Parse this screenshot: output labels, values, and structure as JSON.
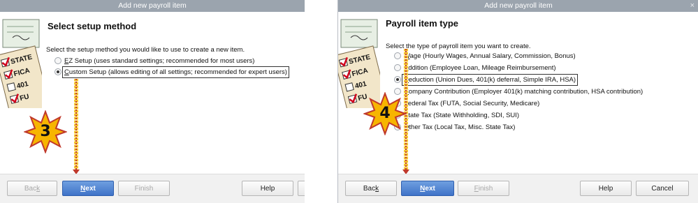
{
  "dialog1": {
    "title": "Add new payroll item",
    "heading": "Select setup method",
    "instruction": "Select the setup method you would like to use to create a new item.",
    "options": [
      {
        "mnemonic": "E",
        "rest": "Z Setup (uses standard settings; recommended for most users)",
        "selected": false
      },
      {
        "mnemonic": "C",
        "rest": "ustom Setup (allows editing of all settings; recommended for expert users)",
        "selected": true
      }
    ],
    "buttons": {
      "back_m": "Bac",
      "back_u": "k",
      "next_u": "N",
      "next_r": "ext",
      "finish": "Finish",
      "help": "Help"
    },
    "step_badge": "3"
  },
  "dialog2": {
    "title": "Add new payroll item",
    "close": "×",
    "heading": "Payroll item type",
    "instruction": "Select the type of payroll item you want to create.",
    "options": [
      {
        "mnemonic": "W",
        "rest": "age (Hourly Wages, Annual Salary, Commission, Bonus)",
        "selected": false
      },
      {
        "mnemonic": "A",
        "rest": "ddition (Employee Loan, Mileage Reimbursement)",
        "selected": false
      },
      {
        "mnemonic": "D",
        "rest": "eduction (Union Dues, 401(k) deferral, Simple IRA, HSA)",
        "selected": true
      },
      {
        "mnemonic": "C",
        "rest": "ompany Contribution (Employer 401(k) matching contribution, HSA contribution)",
        "selected": false
      },
      {
        "mnemonic": "F",
        "rest": "ederal Tax (FUTA, Social Security, Medicare)",
        "selected": false
      },
      {
        "mnemonic": "S",
        "rest": "tate Tax (State Withholding, SDI, SUI)",
        "selected": false
      },
      {
        "mnemonic": "O",
        "rest": "ther Tax (Local Tax, Misc. State Tax)",
        "selected": false
      }
    ],
    "buttons": {
      "back_m": "Bac",
      "back_u": "k",
      "next_u": "N",
      "next_r": "ext",
      "finish_u": "F",
      "finish_r": "inish",
      "help": "Help",
      "cancel": "Cancel"
    },
    "step_badge": "4"
  },
  "art_labels": [
    "STATE",
    "FICA",
    "401",
    "FU"
  ],
  "colors": {
    "titlebar": "#9ba4ae",
    "primary_button": "#4a7fd0",
    "badge_fill": "#f7b500",
    "badge_stroke": "#c0392b",
    "check": "#d0021b"
  }
}
